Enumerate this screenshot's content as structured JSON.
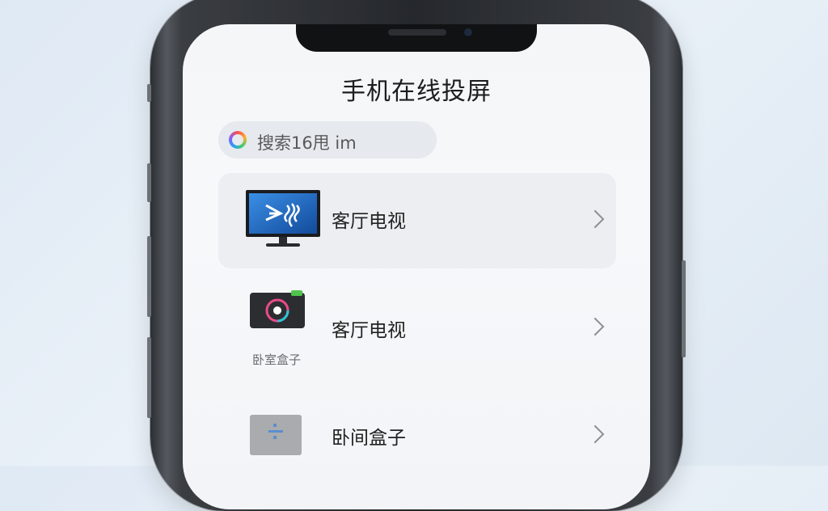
{
  "page": {
    "title": "手机在线投屏"
  },
  "search": {
    "text": "搜索16甩 im"
  },
  "devices": [
    {
      "label": "客厅电视",
      "caption": "",
      "selected": true,
      "icon": "tv-icon"
    },
    {
      "label": "客厅电视",
      "caption": "卧室盒子",
      "selected": false,
      "icon": "camera-box-icon"
    },
    {
      "label": "卧间盒子",
      "caption": "",
      "selected": false,
      "icon": "gray-box-icon"
    }
  ],
  "colors": {
    "accent_blue": "#1f6fd1",
    "selected_row": "#eceef1"
  }
}
